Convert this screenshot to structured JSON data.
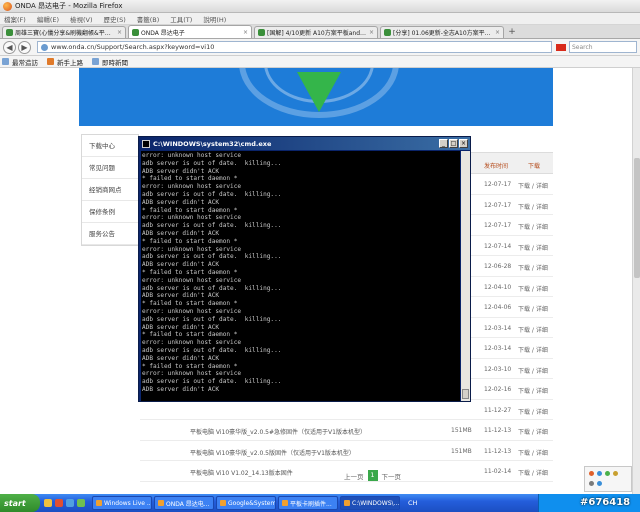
{
  "window": {
    "title": "ONDA 昂达电子 - Mozilla Firefox"
  },
  "menu": [
    "檔案(F)",
    "編輯(E)",
    "檢視(V)",
    "歷史(S)",
    "書籤(B)",
    "工具(T)",
    "說明(H)"
  ],
  "tabs": [
    {
      "label": "周雄三寶(心儀分享&刷機翻帳&平板一..."
    },
    {
      "label": "ONDA 昂达电子"
    },
    {
      "label": "[国解] 4/10更新 A10方案平板android ..."
    },
    {
      "label": "[分享] 01.06更新-全志A10方案平板lu..."
    }
  ],
  "nav": {
    "url": "www.onda.cn/Support/Search.aspx?keyword=vi10",
    "search_placeholder": "Search"
  },
  "bookmarks": [
    "最常造訪",
    "新手上路",
    "即時新聞"
  ],
  "sidemenu": [
    "下载中心",
    "常见问题",
    "经销商网点",
    "保修条例",
    "服务公告"
  ],
  "table": {
    "headers": {
      "date": "发布时间",
      "action": "下载"
    },
    "rows": [
      {
        "name": "",
        "size": "",
        "date": "12-07-17",
        "action": "下载 / 详细"
      },
      {
        "name": "",
        "size": "",
        "date": "12-07-17",
        "action": "下载 / 详细"
      },
      {
        "name": "",
        "size": "",
        "date": "12-07-17",
        "action": "下载 / 详细"
      },
      {
        "name": "",
        "size": "",
        "date": "12-07-14",
        "action": "下载 / 详细"
      },
      {
        "name": "",
        "size": "",
        "date": "12-06-28",
        "action": "下载 / 详细"
      },
      {
        "name": "",
        "size": "",
        "date": "12-04-10",
        "action": "下载 / 详细"
      },
      {
        "name": "",
        "size": "",
        "date": "12-04-06",
        "action": "下载 / 详细"
      },
      {
        "name": "",
        "size": "",
        "date": "12-03-14",
        "action": "下载 / 详细"
      },
      {
        "name": "",
        "size": "",
        "date": "12-03-14",
        "action": "下载 / 详细"
      },
      {
        "name": "",
        "size": "",
        "date": "12-03-10",
        "action": "下载 / 详细"
      },
      {
        "name": "",
        "size": "",
        "date": "12-02-16",
        "action": "下载 / 详细"
      },
      {
        "name": "",
        "size": "",
        "date": "11-12-27",
        "action": "下载 / 详细"
      },
      {
        "name": "平板电脑 Vi10豪华版_v2.0.5#急修固件（仅适用于V1版本机型）",
        "size": "151MB",
        "date": "11-12-13",
        "action": "下载 / 详细"
      },
      {
        "name": "平板电脑 Vi10豪华版_v2.0.5版固件（仅适用于V1版本机型）",
        "size": "151MB",
        "date": "11-12-13",
        "action": "下载 / 详细"
      },
      {
        "name": "平板电脑 Vi10 V1.02_14.13版本固件",
        "size": "",
        "date": "11-02-14",
        "action": "下载 / 详细"
      }
    ]
  },
  "pager": {
    "prev": "上一页",
    "current": "1",
    "next": "下一页"
  },
  "cmd": {
    "title": "C:\\WINDOWS\\system32\\cmd.exe",
    "lines": [
      "error: unknown host service",
      "adb server is out of date.  killing...",
      "ADB server didn't ACK",
      "* failed to start daemon *",
      "error: unknown host service",
      "adb server is out of date.  killing...",
      "ADB server didn't ACK",
      "* failed to start daemon *",
      "error: unknown host service",
      "adb server is out of date.  killing...",
      "ADB server didn't ACK",
      "* failed to start daemon *",
      "error: unknown host service",
      "adb server is out of date.  killing...",
      "ADB server didn't ACK",
      "* failed to start daemon *",
      "error: unknown host service",
      "adb server is out of date.  killing...",
      "ADB server didn't ACK",
      "* failed to start daemon *",
      "error: unknown host service",
      "adb server is out of date.  killing...",
      "ADB server didn't ACK",
      "* failed to start daemon *",
      "error: unknown host service",
      "adb server is out of date.  killing...",
      "ADB server didn't ACK",
      "* failed to start daemon *",
      "error: unknown host service",
      "adb server is out of date.  killing...",
      "ADB server didn't ACK"
    ]
  },
  "taskbar": {
    "start": "start",
    "tasks": [
      "Windows Live ...",
      "ONDA 昂达电...",
      "Google&System",
      "平板卡刷插件...",
      "C:\\WINDOWS\\..."
    ],
    "lang": "CH"
  },
  "watermark": "#676418"
}
